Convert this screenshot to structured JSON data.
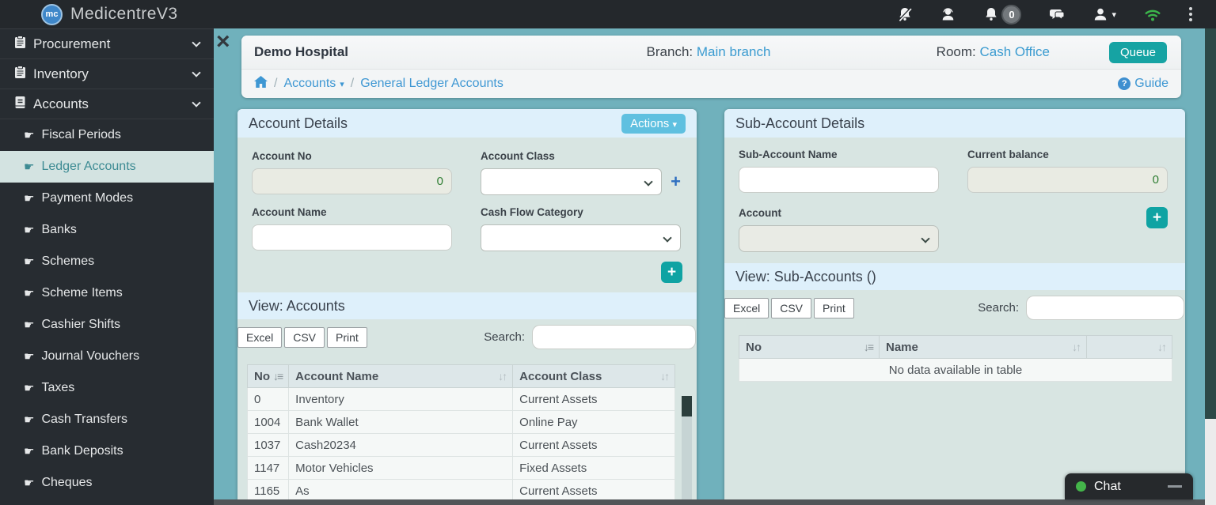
{
  "navbar": {
    "brand": "MedicentreV3",
    "notification_badge": "0"
  },
  "sidebar": {
    "top_items": [
      {
        "label": "Procurement"
      },
      {
        "label": "Inventory"
      },
      {
        "label": "Accounts"
      }
    ],
    "sub_items": [
      "Fiscal Periods",
      "Ledger Accounts",
      "Payment Modes",
      "Banks",
      "Schemes",
      "Scheme Items",
      "Cashier Shifts",
      "Journal Vouchers",
      "Taxes",
      "Cash Transfers",
      "Bank Deposits",
      "Cheques"
    ],
    "active_item": "Ledger Accounts"
  },
  "header": {
    "hospital": "Demo Hospital",
    "branch_label": "Branch:",
    "branch_value": "Main branch",
    "room_label": "Room:",
    "room_value": "Cash Office",
    "queue_button": "Queue"
  },
  "breadcrumb": {
    "accounts": "Accounts",
    "page": "General Ledger Accounts",
    "guide": "Guide",
    "help_glyph": "?"
  },
  "account_details": {
    "title": "Account Details",
    "actions_button": "Actions",
    "account_no_label": "Account No",
    "account_no_value": "0",
    "account_class_label": "Account Class",
    "account_name_label": "Account Name",
    "cash_flow_label": "Cash Flow Category",
    "add_class_glyph": "+",
    "add_account_glyph": "+"
  },
  "accounts_view": {
    "title": "View: Accounts",
    "export_buttons": [
      "Excel",
      "CSV",
      "Print"
    ],
    "search_label": "Search:",
    "search_value": "",
    "table": {
      "columns": [
        "No",
        "Account Name",
        "Account Class"
      ],
      "rows": [
        [
          "0",
          "Inventory",
          "Current Assets"
        ],
        [
          "1004",
          "Bank Wallet",
          "Online Pay"
        ],
        [
          "1037",
          "Cash20234",
          "Current Assets"
        ],
        [
          "1147",
          "Motor Vehicles",
          "Fixed Assets"
        ],
        [
          "1165",
          "As",
          "Current Assets"
        ]
      ]
    }
  },
  "sub_account_details": {
    "title": "Sub-Account Details",
    "name_label": "Sub-Account Name",
    "balance_label": "Current balance",
    "balance_value": "0",
    "account_label": "Account",
    "add_glyph": "+"
  },
  "sub_accounts_view": {
    "title": "View: Sub-Accounts ()",
    "export_buttons": [
      "Excel",
      "CSV",
      "Print"
    ],
    "search_label": "Search:",
    "search_value": "",
    "table": {
      "columns": [
        "No",
        "Name",
        ""
      ],
      "empty_message": "No data available in table"
    }
  },
  "chat": {
    "label": "Chat"
  },
  "colors": {
    "accent_teal": "#16a3a3",
    "actions_blue": "#5fc0e0",
    "link_blue": "#3e97d3",
    "active_sidebar": "#3d8b93",
    "value_green": "#2e7d32",
    "wifi_green": "#3cb54b",
    "main_bg": "#70b1bc"
  }
}
